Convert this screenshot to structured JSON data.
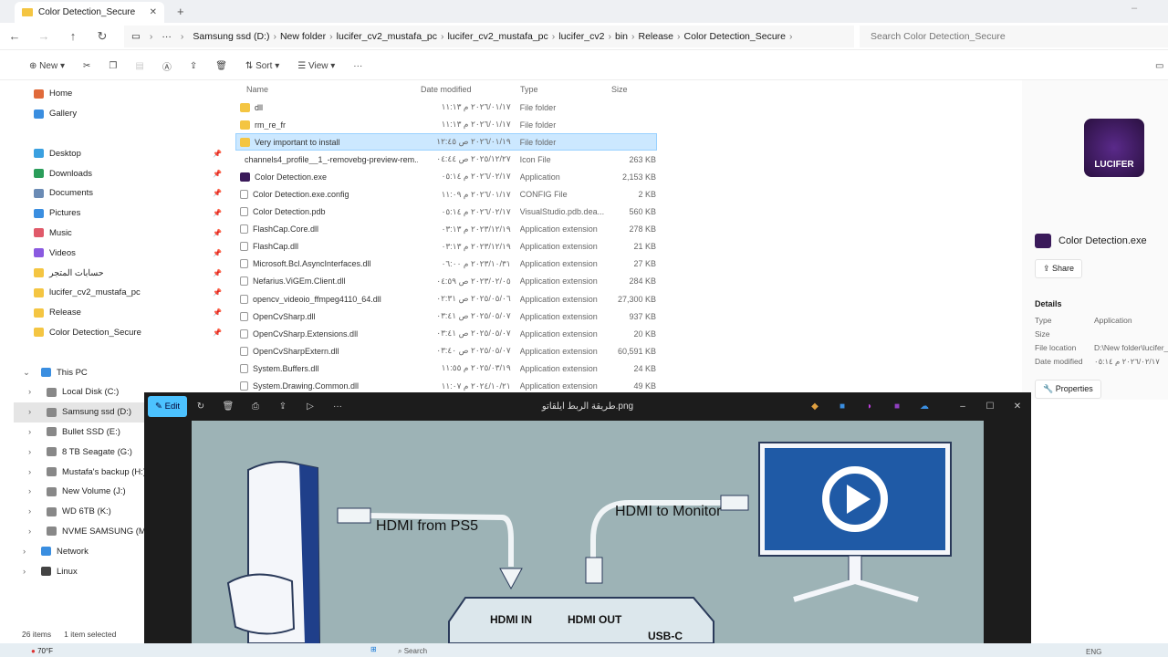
{
  "tab": {
    "title": "Color Detection_Secure"
  },
  "breadcrumb": [
    "Samsung ssd (D:)",
    "New folder",
    "lucifer_cv2_mustafa_pc",
    "lucifer_cv2_mustafa_pc",
    "lucifer_cv2",
    "bin",
    "Release",
    "Color Detection_Secure"
  ],
  "search_placeholder": "Search Color Detection_Secure",
  "toolbar": {
    "new": "New",
    "sort": "Sort",
    "view": "View"
  },
  "sidebar": [
    {
      "label": "Home",
      "icon": "home-icon",
      "color": "#e06a3a"
    },
    {
      "label": "Gallery",
      "icon": "gallery-icon",
      "color": "#3a8ee0"
    },
    {
      "label": "",
      "gap": true
    },
    {
      "label": "Desktop",
      "icon": "desktop-icon",
      "color": "#3aa0e0",
      "pin": true
    },
    {
      "label": "Downloads",
      "icon": "download-icon",
      "color": "#2a9d5a",
      "pin": true
    },
    {
      "label": "Documents",
      "icon": "documents-icon",
      "color": "#6b8bb5",
      "pin": true
    },
    {
      "label": "Pictures",
      "icon": "pictures-icon",
      "color": "#3a8ee0",
      "pin": true
    },
    {
      "label": "Music",
      "icon": "music-icon",
      "color": "#e05a6a",
      "pin": true
    },
    {
      "label": "Videos",
      "icon": "videos-icon",
      "color": "#8a5ae0",
      "pin": true
    },
    {
      "label": "حسابات المتجر",
      "icon": "folder-icon",
      "color": "#f4c542",
      "pin": true
    },
    {
      "label": "lucifer_cv2_mustafa_pc",
      "icon": "folder-icon",
      "color": "#f4c542",
      "pin": true
    },
    {
      "label": "Release",
      "icon": "folder-icon",
      "color": "#f4c542",
      "pin": true
    },
    {
      "label": "Color Detection_Secure",
      "icon": "folder-icon",
      "color": "#f4c542",
      "pin": true
    },
    {
      "label": "",
      "gap": true
    },
    {
      "label": "This PC",
      "icon": "pc-icon",
      "color": "#3a8ee0",
      "tree": "v"
    },
    {
      "label": "Local Disk (C:)",
      "icon": "drive-icon",
      "color": "#888",
      "tree": ">",
      "indent": true
    },
    {
      "label": "Samsung ssd (D:)",
      "icon": "drive-icon",
      "color": "#888",
      "tree": ">",
      "indent": true,
      "selected": true
    },
    {
      "label": "Bullet SSD (E:)",
      "icon": "drive-icon",
      "color": "#888",
      "tree": ">",
      "indent": true
    },
    {
      "label": "8 TB Seagate (G:)",
      "icon": "drive-icon",
      "color": "#888",
      "tree": ">",
      "indent": true
    },
    {
      "label": "Mustafa's backup (H:)",
      "icon": "drive-icon",
      "color": "#888",
      "tree": ">",
      "indent": true
    },
    {
      "label": "New Volume (J:)",
      "icon": "drive-icon",
      "color": "#888",
      "tree": ">",
      "indent": true
    },
    {
      "label": "WD 6TB (K:)",
      "icon": "drive-icon",
      "color": "#888",
      "tree": ">",
      "indent": true
    },
    {
      "label": "NVME SAMSUNG (M:)",
      "icon": "drive-icon",
      "color": "#888",
      "tree": ">",
      "indent": true
    },
    {
      "label": "Network",
      "icon": "network-icon",
      "color": "#3a8ee0",
      "tree": ">"
    },
    {
      "label": "Linux",
      "icon": "linux-icon",
      "color": "#444",
      "tree": ">"
    }
  ],
  "columns": [
    "Name",
    "Date modified",
    "Type",
    "Size"
  ],
  "files": [
    {
      "name": "dll",
      "date": "٢٠٢٦/٠١/١٧ م ١١:١٣",
      "type": "File folder",
      "size": "",
      "kind": "folder"
    },
    {
      "name": "rm_re_fr",
      "date": "٢٠٢٦/٠١/١٧ م ١١:١٣",
      "type": "File folder",
      "size": "",
      "kind": "folder"
    },
    {
      "name": "Very important to install",
      "date": "٢٠٢٦/٠١/١٩ ص ١٢:٤٥",
      "type": "File folder",
      "size": "",
      "kind": "folder",
      "selected": true
    },
    {
      "name": "channels4_profile__1_-removebg-preview-rem...",
      "date": "٢٠٢٥/١٢/٢٧ ص ٠٤:٤٤",
      "type": "Icon File",
      "size": "263 KB",
      "kind": "app"
    },
    {
      "name": "Color Detection.exe",
      "date": "٢٠٢٦/٠٢/١٧ م ٠٥:١٤",
      "type": "Application",
      "size": "2,153 KB",
      "kind": "app"
    },
    {
      "name": "Color Detection.exe.config",
      "date": "٢٠٢٦/٠١/١٧ م ١١:٠٩",
      "type": "CONFIG File",
      "size": "2 KB",
      "kind": "file"
    },
    {
      "name": "Color Detection.pdb",
      "date": "٢٠٢٦/٠٢/١٧ م ٠٥:١٤",
      "type": "VisualStudio.pdb.dea...",
      "size": "560 KB",
      "kind": "file"
    },
    {
      "name": "FlashCap.Core.dll",
      "date": "٢٠٢٣/١٢/١٩ م ٠٣:١٣",
      "type": "Application extension",
      "size": "278 KB",
      "kind": "dll"
    },
    {
      "name": "FlashCap.dll",
      "date": "٢٠٢٣/١٢/١٩ م ٠٣:١٣",
      "type": "Application extension",
      "size": "21 KB",
      "kind": "dll"
    },
    {
      "name": "Microsoft.Bcl.AsyncInterfaces.dll",
      "date": "٢٠٢٣/١٠/٣١ م ٠٦:٠٠",
      "type": "Application extension",
      "size": "27 KB",
      "kind": "dll"
    },
    {
      "name": "Nefarius.ViGEm.Client.dll",
      "date": "٢٠٢٣/٠٢/٠٥ ص ٠٤:٥٩",
      "type": "Application extension",
      "size": "284 KB",
      "kind": "dll"
    },
    {
      "name": "opencv_videoio_ffmpeg4110_64.dll",
      "date": "٢٠٢٥/٠٥/٠٦ ص ٠٢:٣١",
      "type": "Application extension",
      "size": "27,300 KB",
      "kind": "dll"
    },
    {
      "name": "OpenCvSharp.dll",
      "date": "٢٠٢٥/٠٥/٠٧ ص ٠٣:٤١",
      "type": "Application extension",
      "size": "937 KB",
      "kind": "dll"
    },
    {
      "name": "OpenCvSharp.Extensions.dll",
      "date": "٢٠٢٥/٠٥/٠٧ ص ٠٣:٤١",
      "type": "Application extension",
      "size": "20 KB",
      "kind": "dll"
    },
    {
      "name": "OpenCvSharpExtern.dll",
      "date": "٢٠٢٥/٠٥/٠٧ ص ٠٣:٤٠",
      "type": "Application extension",
      "size": "60,591 KB",
      "kind": "dll"
    },
    {
      "name": "System.Buffers.dll",
      "date": "٢٠٢٥/٠٣/١٩ م ١١:٥٥",
      "type": "Application extension",
      "size": "24 KB",
      "kind": "dll"
    },
    {
      "name": "System.Drawing.Common.dll",
      "date": "٢٠٢٤/١٠/٢١ م ١١:٠٧",
      "type": "Application extension",
      "size": "49 KB",
      "kind": "dll"
    }
  ],
  "details": {
    "logo_text": "LUCIFER",
    "filename": "Color Detection.exe",
    "share": "Share",
    "heading": "Details",
    "rows": [
      {
        "k": "Type",
        "v": "Application"
      },
      {
        "k": "Size",
        "v": ""
      },
      {
        "k": "File location",
        "v": "D:\\New folder\\lucifer_"
      },
      {
        "k": "Date modified",
        "v": "٢٠٢٦/٠٢/١٧ م ٠٥:١٤"
      }
    ],
    "properties": "Properties"
  },
  "status": {
    "items": "26 items",
    "selected": "1 item selected"
  },
  "viewer": {
    "edit": "Edit",
    "title": "طريقة الربط ايلقاتو.png",
    "image": {
      "hdmi_from": "HDMI from PS5",
      "hdmi_to": "HDMI to Monitor",
      "hdmi_in": "HDMI IN",
      "hdmi_out": "HDMI OUT",
      "usbc": "USB-C"
    }
  },
  "taskbar": {
    "weather": "70°F",
    "search": "Search",
    "lang": "ENG"
  },
  "colors": {
    "accent": "#4cc2ff",
    "selection": "#cce8ff",
    "viewer_bg": "#1c1c1c",
    "monitor": "#1f5aa6"
  }
}
